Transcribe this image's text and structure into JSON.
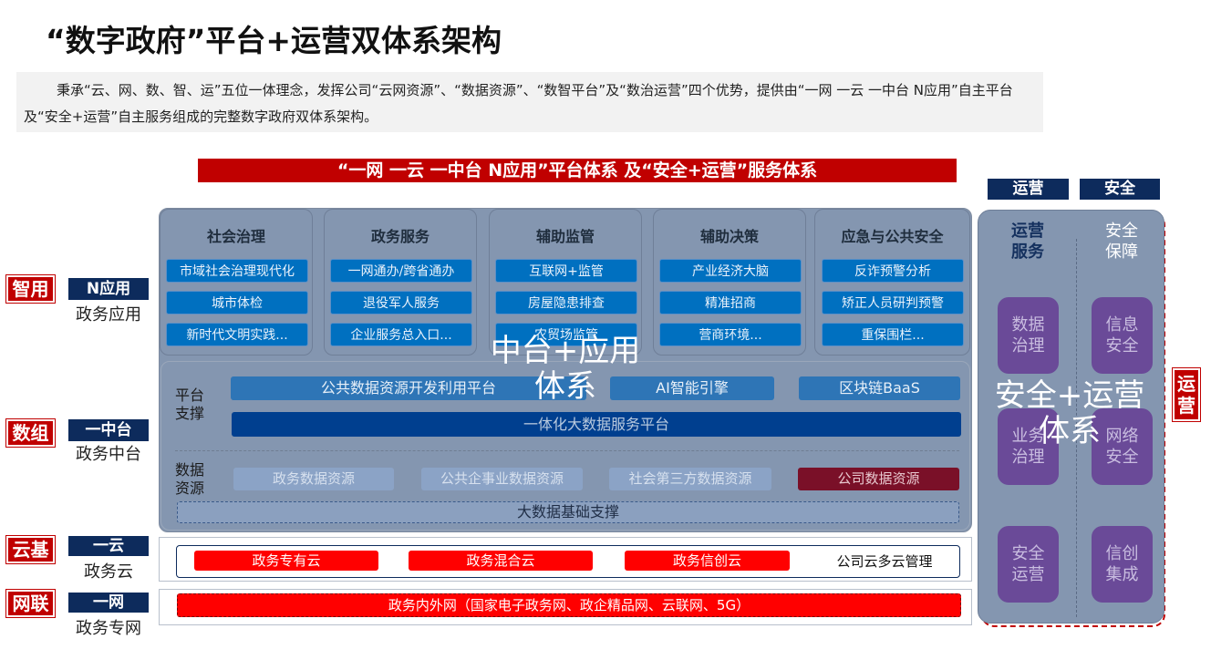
{
  "title": "“数字政府”平台+运营双体系架构",
  "intro": "秉承“云、网、数、智、运”五位一体理念，发挥公司“云网资源”、“数据资源”、“数智平台”及“数治运营”四个优势，提供由“一网 一云 一中台 N应用”自主平台 及“安全+运营”自主服务组成的完整数字政府双体系架构。",
  "banner": "“一网 一云 一中台 N应用”平台体系 及“安全+运营”服务体系",
  "top_tags": {
    "ops": "运营",
    "security": "安全"
  },
  "layers": [
    {
      "tag": "智用",
      "label": "N应用",
      "sub": "政务应用"
    },
    {
      "tag": "数组",
      "label": "一中台",
      "sub": "政务中台"
    },
    {
      "tag": "云基",
      "label": "一云",
      "sub": "政务云"
    },
    {
      "tag": "网联",
      "label": "一网",
      "sub": "政务专网"
    }
  ],
  "app_categories": [
    {
      "title": "社会治理",
      "items": [
        "市域社会治理现代化",
        "城市体检",
        "新时代文明实践..."
      ]
    },
    {
      "title": "政务服务",
      "items": [
        "一网通办/跨省通办",
        "退役军人服务",
        "企业服务总入口..."
      ]
    },
    {
      "title": "辅助监管",
      "items": [
        "互联网+监管",
        "房屋隐患排查",
        "农贸场监管"
      ]
    },
    {
      "title": "辅助决策",
      "items": [
        "产业经济大脑",
        "精准招商",
        "营商环境..."
      ]
    },
    {
      "title": "应急与公共安全",
      "items": [
        "反诈预警分析",
        "矫正人员研判预警",
        "重保围栏..."
      ]
    }
  ],
  "platform": {
    "label": "平台\n支撑",
    "items": [
      "公共数据资源开发利用平台",
      "AI智能引擎",
      "区块链BaaS"
    ],
    "bigdata": "一体化大数据服务平台"
  },
  "data_resources": {
    "label": "数据\n资源",
    "items": [
      "政务数据资源",
      "公共企事业数据资源",
      "社会第三方数据资源",
      "公司数据资源"
    ],
    "base": "大数据基础支撑"
  },
  "overlay_center": "中台+应用\n体系",
  "cloud": {
    "items": [
      "政务专有云",
      "政务混合云",
      "政务信创云"
    ],
    "mgmt": "公司云多云管理"
  },
  "network": "政务内外网（国家电子政务网、政企精品网、云联网、5G）",
  "right_panel": {
    "col1_title": "运营\n服务",
    "col2_title": "安全\n保障",
    "col1": [
      "数据\n治理",
      "业务\n治理",
      "安全\n运营"
    ],
    "col2": [
      "信息\n安全",
      "网络\n安全",
      "信创\n集成"
    ],
    "overlay": "安全+运营\n体系"
  },
  "side_ops": "运\n营",
  "colors": {
    "red": "#c00000",
    "navy": "#0d2b5c",
    "blue": "#0070c0",
    "purple": "#6a4a98",
    "panel": "#8496b0"
  }
}
